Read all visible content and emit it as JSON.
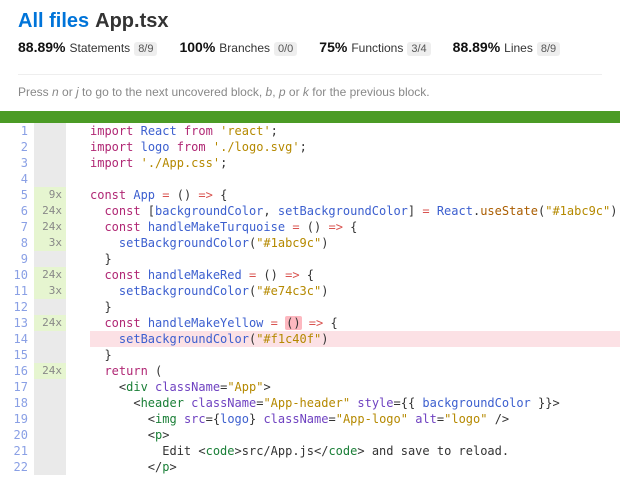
{
  "header": {
    "all_files_label": "All files",
    "file_name": "App.tsx"
  },
  "metrics": [
    {
      "pct": "88.89%",
      "label": "Statements",
      "frac": "8/9"
    },
    {
      "pct": "100%",
      "label": "Branches",
      "frac": "0/0"
    },
    {
      "pct": "75%",
      "label": "Functions",
      "frac": "3/4"
    },
    {
      "pct": "88.89%",
      "label": "Lines",
      "frac": "8/9"
    }
  ],
  "hint": {
    "prefix": "Press ",
    "k1": "n",
    "or1": " or ",
    "k2": "j",
    "mid": " to go to the next uncovered block, ",
    "k3": "b",
    "c1": ", ",
    "k4": "p",
    "or2": " or ",
    "k5": "k",
    "suffix": " for the previous block."
  },
  "status_color": "#4b9b25",
  "lines": [
    {
      "n": 1,
      "cov": "",
      "hit": false,
      "kind": "import1"
    },
    {
      "n": 2,
      "cov": "",
      "hit": false,
      "kind": "import2"
    },
    {
      "n": 3,
      "cov": "",
      "hit": false,
      "kind": "import3"
    },
    {
      "n": 4,
      "cov": "",
      "hit": false,
      "kind": "blank"
    },
    {
      "n": 5,
      "cov": "9x",
      "hit": true,
      "kind": "appdecl"
    },
    {
      "n": 6,
      "cov": "24x",
      "hit": true,
      "kind": "usestate"
    },
    {
      "n": 7,
      "cov": "24x",
      "hit": true,
      "kind": "turqdecl"
    },
    {
      "n": 8,
      "cov": "3x",
      "hit": true,
      "kind": "turqbody"
    },
    {
      "n": 9,
      "cov": "",
      "hit": false,
      "kind": "close1"
    },
    {
      "n": 10,
      "cov": "24x",
      "hit": true,
      "kind": "reddecl"
    },
    {
      "n": 11,
      "cov": "3x",
      "hit": true,
      "kind": "redbody"
    },
    {
      "n": 12,
      "cov": "",
      "hit": false,
      "kind": "close1"
    },
    {
      "n": 13,
      "cov": "24x",
      "hit": true,
      "kind": "yellowdecl"
    },
    {
      "n": 14,
      "cov": "",
      "hit": false,
      "kind": "yellowbody"
    },
    {
      "n": 15,
      "cov": "",
      "hit": false,
      "kind": "close1"
    },
    {
      "n": 16,
      "cov": "24x",
      "hit": true,
      "kind": "return"
    },
    {
      "n": 17,
      "cov": "",
      "hit": false,
      "kind": "div"
    },
    {
      "n": 18,
      "cov": "",
      "hit": false,
      "kind": "header"
    },
    {
      "n": 19,
      "cov": "",
      "hit": false,
      "kind": "img"
    },
    {
      "n": 20,
      "cov": "",
      "hit": false,
      "kind": "popen"
    },
    {
      "n": 21,
      "cov": "",
      "hit": false,
      "kind": "edit"
    },
    {
      "n": 22,
      "cov": "",
      "hit": false,
      "kind": "pclose"
    }
  ],
  "code_strings": {
    "react": "'react'",
    "logosvg": "'./logo.svg'",
    "appcss": "'./App.css'",
    "color_turq": "\"#1abc9c\"",
    "color_red": "\"#e74c3c\"",
    "color_yellow": "\"#f1c40f\"",
    "app": "\"App\"",
    "app_header": "\"App-header\"",
    "app_logo": "\"App-logo\"",
    "logo_alt": "\"logo\"",
    "src_app": "src/App.js",
    "edit_prefix": "Edit ",
    "edit_suffix": " and save to reload."
  }
}
